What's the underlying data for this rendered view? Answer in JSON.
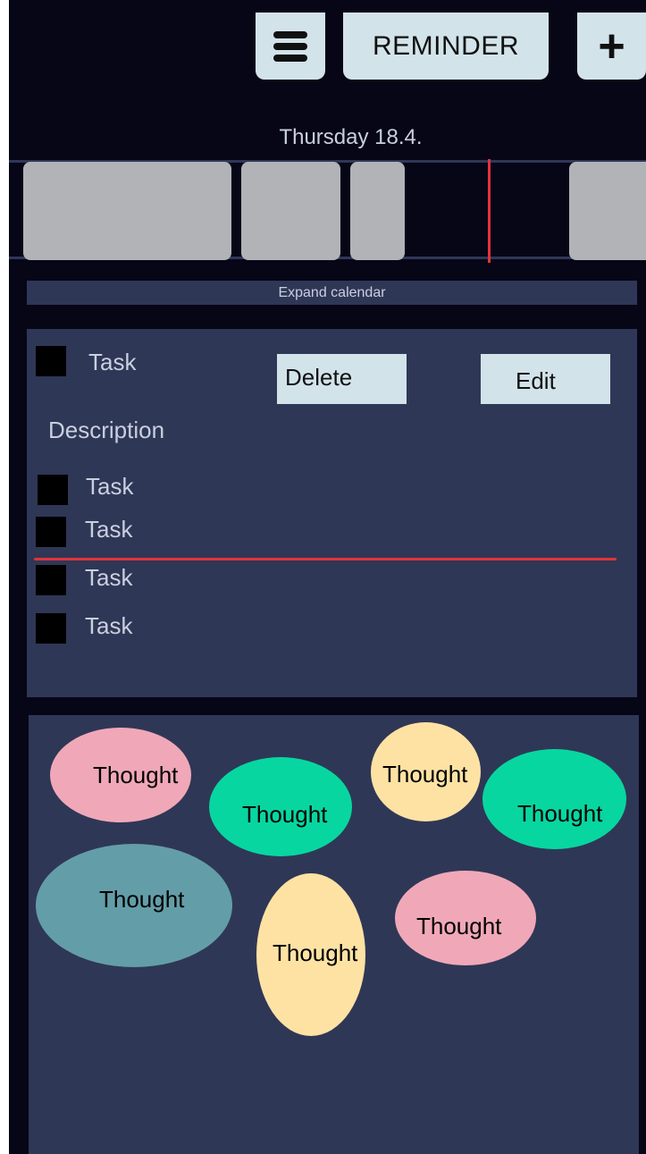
{
  "header": {
    "reminder_label": "REMINDER",
    "add_label": "+",
    "menu_icon": "hamburger-menu-icon"
  },
  "calendar": {
    "date": "Thursday 18.4.",
    "expand_label": "Expand calendar"
  },
  "tasks": {
    "delete_label": "Delete",
    "edit_label": "Edit",
    "description": "Description",
    "items": [
      {
        "label": "Task"
      },
      {
        "label": "Task"
      },
      {
        "label": "Task"
      },
      {
        "label": "Task"
      },
      {
        "label": "Task"
      }
    ]
  },
  "thoughts": {
    "items": [
      {
        "label": "Thought",
        "color": "#f0a8b8"
      },
      {
        "label": "Thought",
        "color": "#08d6a0"
      },
      {
        "label": "Thought",
        "color": "#fde2a4"
      },
      {
        "label": "Thought",
        "color": "#08d6a0"
      },
      {
        "label": "Thought",
        "color": "#639ea8"
      },
      {
        "label": "Thought",
        "color": "#fde2a4"
      },
      {
        "label": "Thought",
        "color": "#f0a8b8"
      }
    ]
  },
  "colors": {
    "background": "#070617",
    "panel": "#2f3756",
    "button": "#d3e3ea",
    "calendar_block": "#b2b3b7",
    "accent_red": "#e2333b"
  }
}
